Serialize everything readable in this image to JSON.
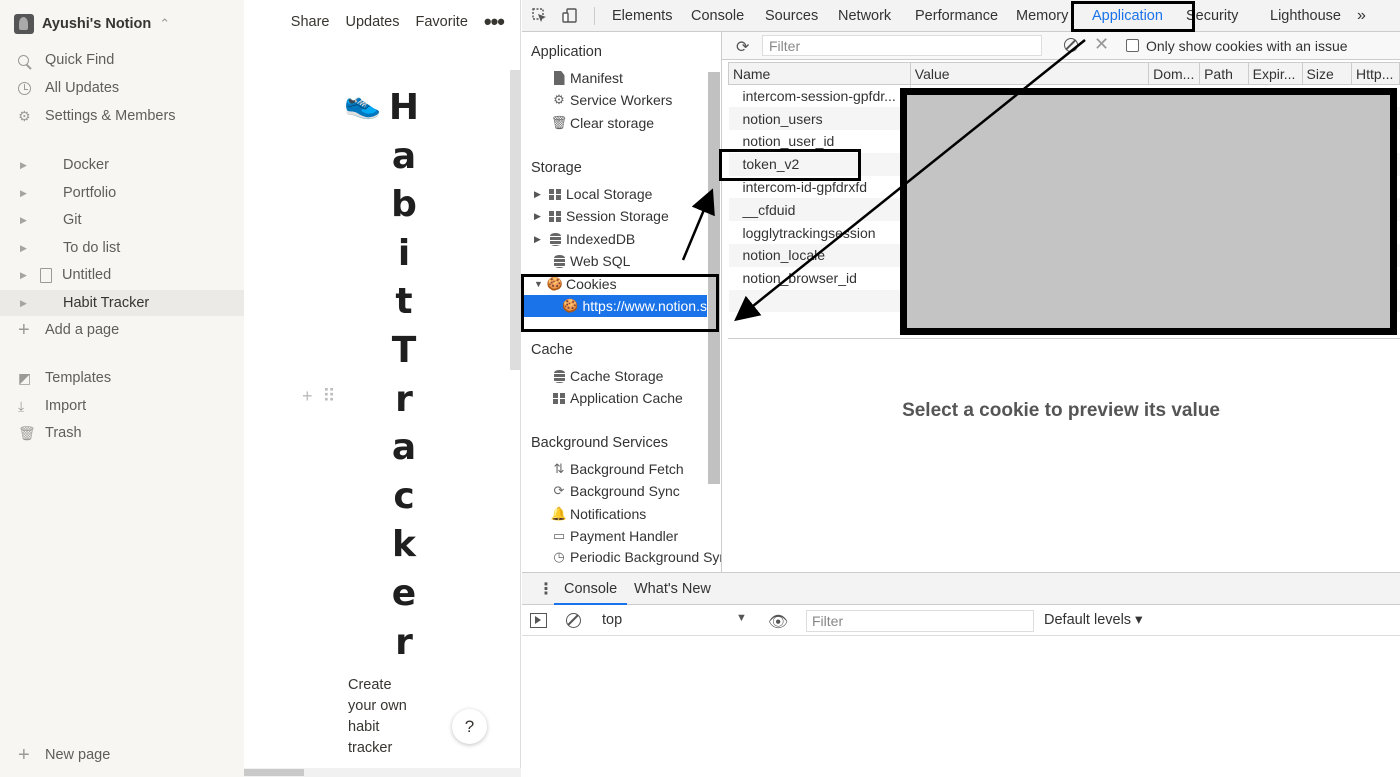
{
  "notion": {
    "workspace": "Ayushi's Notion",
    "workspace_chevron": "⌃",
    "quick_links": [
      "Quick Find",
      "All Updates",
      "Settings & Members"
    ],
    "pages": [
      "Docker",
      "Portfolio",
      "Git",
      "To do list",
      "Untitled",
      "Habit Tracker"
    ],
    "add_page": "Add a page",
    "tools": [
      "Templates",
      "Import",
      "Trash"
    ],
    "new_page": "New page",
    "topbar": {
      "share": "Share",
      "updates": "Updates",
      "favorite": "Favorite",
      "more": "•••"
    },
    "page_title_letters": [
      "H",
      "a",
      "b",
      "i",
      "t",
      "T",
      "r",
      "a",
      "c",
      "k",
      "e",
      "r"
    ],
    "page_icon": "👟",
    "description": "Create your own habit tracker",
    "help": "?"
  },
  "devtools": {
    "tabs": [
      "Elements",
      "Console",
      "Sources",
      "Network",
      "Performance",
      "Memory",
      "Application",
      "Security",
      "Lighthouse"
    ],
    "tabs_overflow": "»",
    "active_tab": "Application",
    "sidebar": {
      "application_header": "Application",
      "application_items": [
        "Manifest",
        "Service Workers",
        "Clear storage"
      ],
      "storage_header": "Storage",
      "storage_items": [
        "Local Storage",
        "Session Storage",
        "IndexedDB",
        "Web SQL",
        "Cookies"
      ],
      "cookie_origin": "https://www.notion.s",
      "cache_header": "Cache",
      "cache_items": [
        "Cache Storage",
        "Application Cache"
      ],
      "bg_header": "Background Services",
      "bg_items": [
        "Background Fetch",
        "Background Sync",
        "Notifications",
        "Payment Handler",
        "Periodic Background Sync"
      ]
    },
    "cookie_toolbar": {
      "filter_placeholder": "Filter",
      "only_issue_label": "Only show cookies with an issue"
    },
    "cookie_columns": [
      "Name",
      "Value",
      "Dom...",
      "Path",
      "Expir...",
      "Size",
      "Http..."
    ],
    "cookie_names": [
      "intercom-session-gpfdr...",
      "notion_users",
      "notion_user_id",
      "token_v2",
      "intercom-id-gpfdrxfd",
      "__cfduid",
      "logglytrackingsession",
      "notion_locale",
      "notion_browser_id"
    ],
    "preview_message": "Select a cookie to preview its value",
    "drawer": {
      "tabs": [
        "Console",
        "What's New"
      ],
      "context": "top",
      "filter_placeholder": "Filter",
      "levels": "Default levels ▾"
    }
  },
  "colors": {
    "accent": "#1a73e8",
    "sidebar_bg": "#f7f6f3",
    "annotation": "#000000"
  }
}
